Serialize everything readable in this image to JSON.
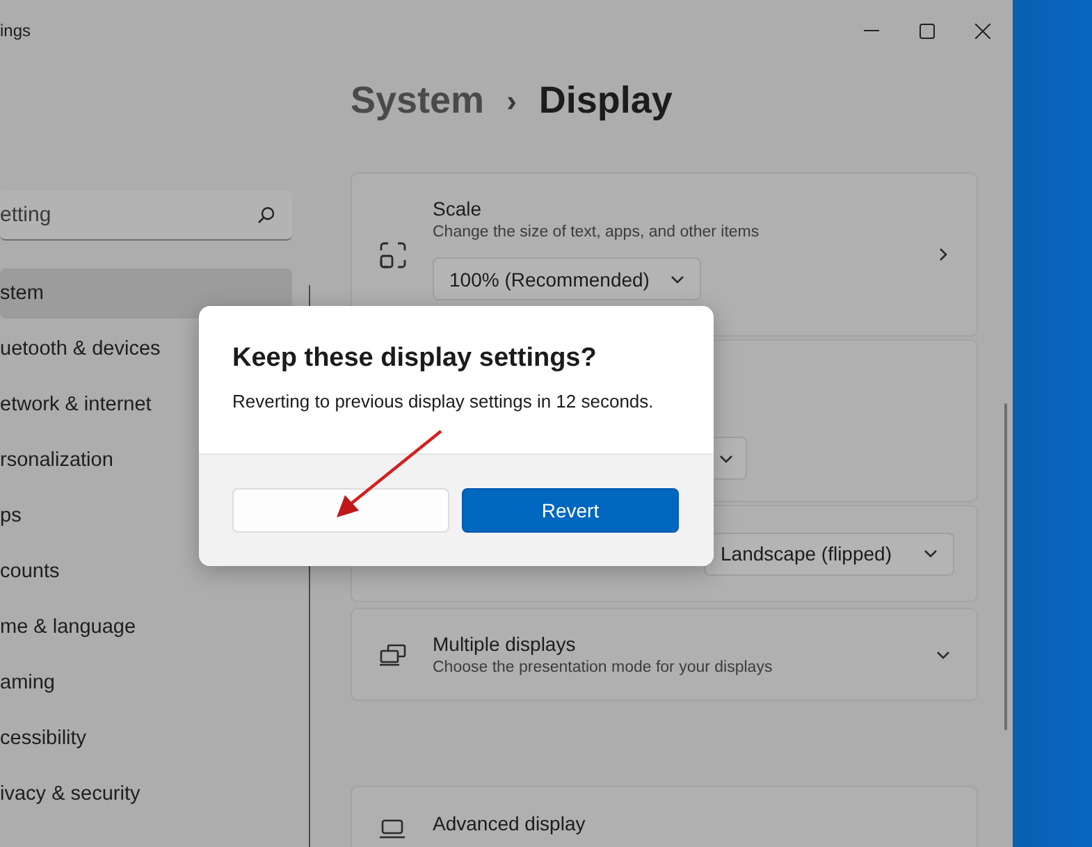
{
  "window": {
    "title": "ings"
  },
  "sidebar": {
    "search": {
      "placeholder": "etting"
    },
    "items": [
      {
        "label": "stem",
        "selected": true
      },
      {
        "label": "uetooth & devices",
        "selected": false
      },
      {
        "label": "etwork & internet",
        "selected": false
      },
      {
        "label": "rsonalization",
        "selected": false
      },
      {
        "label": "ps",
        "selected": false
      },
      {
        "label": "counts",
        "selected": false
      },
      {
        "label": "me & language",
        "selected": false
      },
      {
        "label": "aming",
        "selected": false
      },
      {
        "label": "cessibility",
        "selected": false
      },
      {
        "label": "ivacy & security",
        "selected": false
      }
    ]
  },
  "header": {
    "parent": "System",
    "separator": "›",
    "current": "Display"
  },
  "cards": [
    {
      "kind": "link",
      "title": "Scale",
      "description": "Change the size of text, apps, and other items",
      "dropdown": "100% (Recommended)"
    },
    {
      "kind": "covered"
    },
    {
      "kind": "select",
      "dropdown": "Landscape (flipped)"
    },
    {
      "kind": "expander",
      "title": "Multiple displays",
      "description": "Choose the presentation mode for your displays"
    },
    {
      "kind": "footer",
      "title": "Advanced display"
    }
  ],
  "dialog": {
    "title": "Keep these display settings?",
    "message": "Reverting to previous display settings in 12 seconds.",
    "buttons": [
      {
        "kind": "secondary"
      },
      {
        "kind": "primary",
        "label": "Revert"
      }
    ]
  }
}
